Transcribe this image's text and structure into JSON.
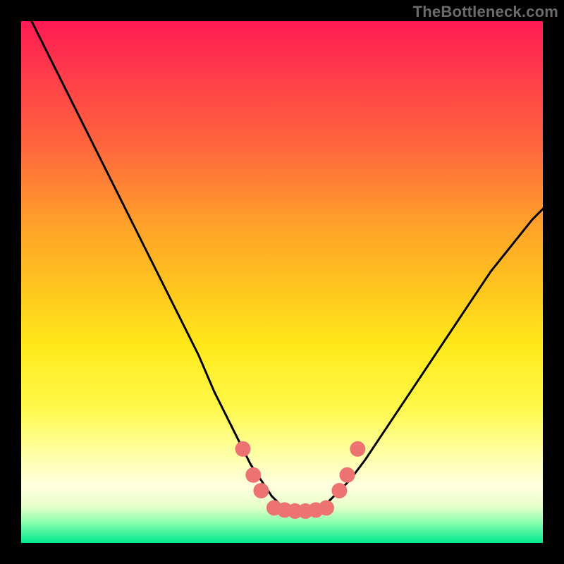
{
  "watermark": "TheBottleneck.com",
  "chart_data": {
    "type": "line",
    "title": "",
    "xlabel": "",
    "ylabel": "",
    "xlim": [
      0,
      100
    ],
    "ylim": [
      0,
      100
    ],
    "series": [
      {
        "name": "bottleneck-curve",
        "x": [
          2,
          6,
          10,
          14,
          18,
          22,
          26,
          30,
          34,
          37,
          40,
          42,
          44,
          46,
          48,
          50,
          52,
          54,
          56,
          58,
          60,
          63,
          66,
          70,
          74,
          78,
          82,
          86,
          90,
          94,
          98,
          100
        ],
        "y": [
          100,
          92,
          84,
          76,
          68,
          60,
          52,
          44,
          36,
          29,
          23,
          19,
          15,
          12,
          9,
          7,
          6,
          6,
          6,
          7,
          9,
          12,
          16,
          22,
          28,
          34,
          40,
          46,
          52,
          57,
          62,
          64
        ]
      }
    ],
    "markers": {
      "name": "highlighted-points",
      "color": "#ed7272",
      "points": [
        {
          "x": 42.5,
          "y": 18
        },
        {
          "x": 44.5,
          "y": 13
        },
        {
          "x": 46.0,
          "y": 10
        },
        {
          "x": 48.5,
          "y": 6.7
        },
        {
          "x": 50.5,
          "y": 6.3
        },
        {
          "x": 52.5,
          "y": 6.1
        },
        {
          "x": 54.5,
          "y": 6.1
        },
        {
          "x": 56.5,
          "y": 6.3
        },
        {
          "x": 58.5,
          "y": 6.7
        },
        {
          "x": 61.0,
          "y": 10
        },
        {
          "x": 62.5,
          "y": 13
        },
        {
          "x": 64.5,
          "y": 18
        }
      ]
    },
    "gradient_stops": [
      {
        "pct": 0,
        "color": "#ff1a54"
      },
      {
        "pct": 10,
        "color": "#ff3b4a"
      },
      {
        "pct": 25,
        "color": "#ff6a3c"
      },
      {
        "pct": 40,
        "color": "#ffa528"
      },
      {
        "pct": 52,
        "color": "#ffc81e"
      },
      {
        "pct": 62,
        "color": "#ffe81a"
      },
      {
        "pct": 74,
        "color": "#fff94a"
      },
      {
        "pct": 83,
        "color": "#ffffa5"
      },
      {
        "pct": 89,
        "color": "#ffffe0"
      },
      {
        "pct": 93,
        "color": "#e8ffc8"
      },
      {
        "pct": 96,
        "color": "#8cffb0"
      },
      {
        "pct": 100,
        "color": "#00e88c"
      }
    ]
  }
}
